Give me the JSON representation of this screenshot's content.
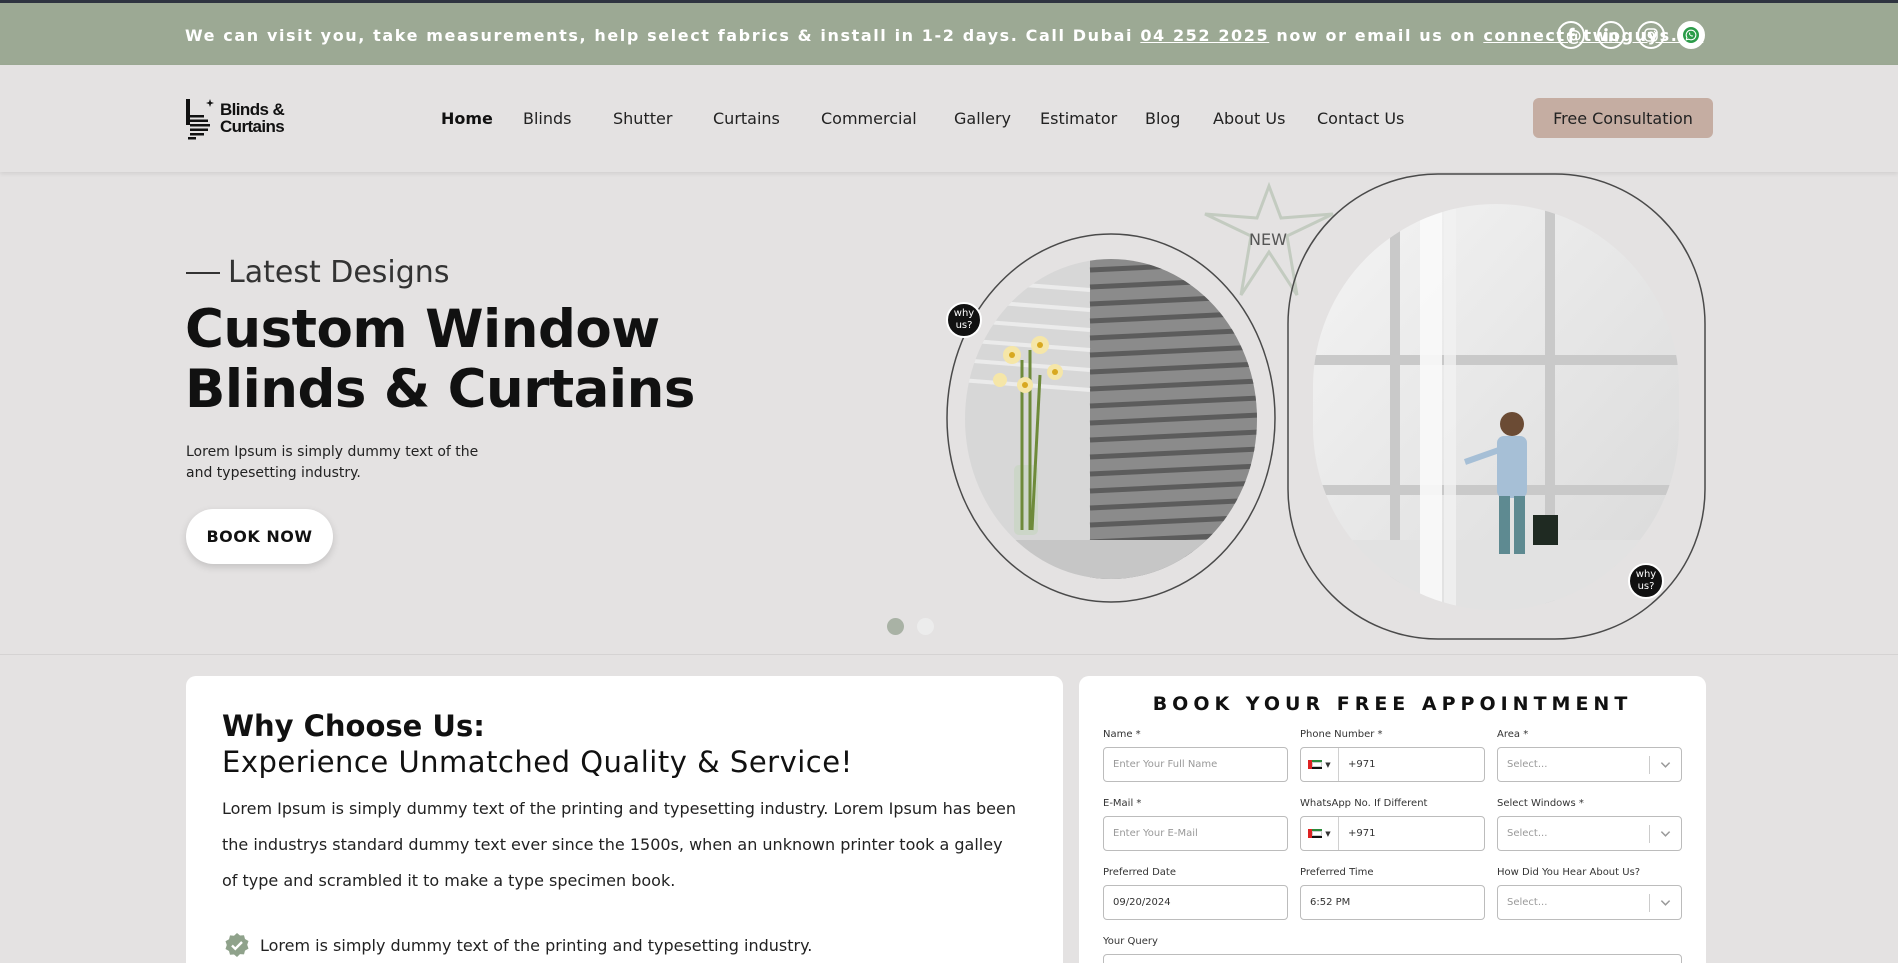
{
  "topbar": {
    "text_before_phone": "We can visit you, take measurements, help select fabrics & install in 1-2 days. Call Dubai ",
    "phone": "04 252 2025",
    "text_middle": " now or email us on ",
    "email": "connect@twoguys.ae",
    "socials": [
      "facebook-icon",
      "linkedin-icon",
      "instagram-icon",
      "whatsapp-icon"
    ]
  },
  "header": {
    "logo_line1": "Blinds &",
    "logo_line2": "Curtains",
    "nav": {
      "home": "Home",
      "blinds": "Blinds",
      "shutter": "Shutter",
      "curtains": "Curtains",
      "commercial": "Commercial",
      "gallery": "Gallery",
      "estimator": "Estimator",
      "blog": "Blog",
      "about": "About Us",
      "contact": "Contact Us"
    },
    "cta": "Free Consultation"
  },
  "hero": {
    "eyebrow": "Latest Designs",
    "title_line1": "Custom Window",
    "title_line2": "Blinds & Curtains",
    "subtitle": "Lorem Ipsum is simply dummy text of the and typesetting industry.",
    "button": "BOOK NOW",
    "badge_text": "why us?",
    "new_label": "NEW",
    "slides": 2,
    "active_slide": 1
  },
  "why": {
    "title": "Why Choose Us:",
    "subtitle": "Experience Unmatched Quality & Service!",
    "body": "Lorem Ipsum is simply dummy text of the printing and typesetting industry. Lorem Ipsum has been the industrys standard dummy text ever since the 1500s, when an unknown printer took a galley of type and scrambled it to make a type specimen book.",
    "point": "Lorem is simply dummy text of the printing and typesetting industry."
  },
  "form": {
    "title": "BOOK YOUR FREE APPOINTMENT",
    "name_label": "Name *",
    "name_placeholder": "Enter Your Full Name",
    "phone_label": "Phone Number *",
    "phone_code": "+971",
    "area_label": "Area *",
    "area_placeholder": "Select...",
    "email_label": "E-Mail *",
    "email_placeholder": "Enter Your E-Mail",
    "whatsapp_label": "WhatsApp No. If Different",
    "whatsapp_code": "+971",
    "windows_label": "Select Windows *",
    "windows_placeholder": "Select...",
    "date_label": "Preferred Date",
    "date_value": "09/20/2024",
    "time_label": "Preferred Time",
    "time_value": "6:52 PM",
    "hear_label": "How Did You Hear About Us?",
    "hear_placeholder": "Select...",
    "query_label": "Your Query"
  },
  "colors": {
    "topbar": "#9ca994",
    "cta": "#c5ada2",
    "background": "#e4e2e2",
    "badge": "#111111"
  }
}
